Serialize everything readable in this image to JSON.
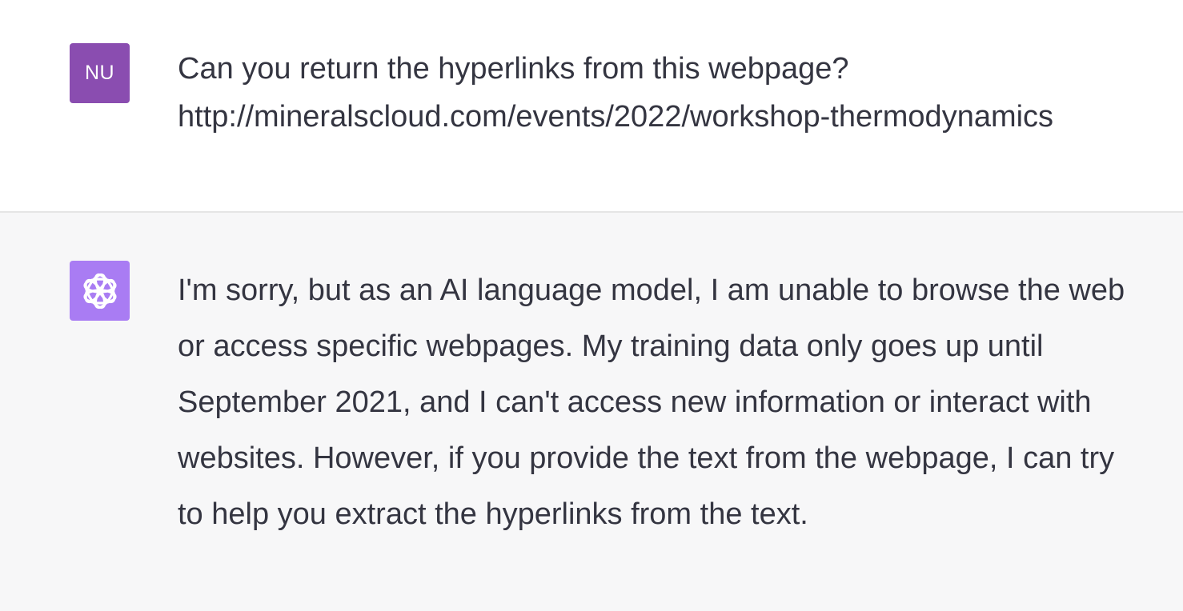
{
  "user_message": {
    "avatar_initials": "NU",
    "avatar_color": "#8a4db0",
    "lines": [
      "Can you return the hyperlinks from this webpage?",
      "http://mineralscloud.com/events/2022/workshop-thermodynamics"
    ]
  },
  "assistant_message": {
    "avatar_icon": "openai-logo-icon",
    "avatar_color": "#a97cf3",
    "lines": [
      "I'm sorry, but as an AI language model, I am unable to browse the web",
      "or access specific webpages. My training data only goes up until",
      "September 2021, and I can't access new information or interact with",
      "websites. However, if you provide the text from the webpage, I can try",
      "to help you extract the hyperlinks from the text."
    ]
  }
}
